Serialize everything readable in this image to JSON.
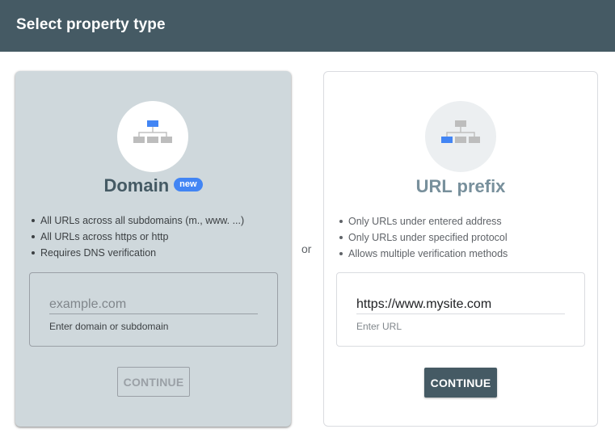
{
  "header": {
    "title": "Select property type"
  },
  "or_label": "or",
  "domain_card": {
    "title": "Domain",
    "badge": "new",
    "bullets": [
      "All URLs across all subdomains (m., www. ...)",
      "All URLs across https or http",
      "Requires DNS verification"
    ],
    "input": {
      "value": "",
      "placeholder": "example.com",
      "helper": "Enter domain or subdomain"
    },
    "continue_label": "CONTINUE",
    "continue_state": "disabled",
    "icon": "domain-hierarchy-icon"
  },
  "url_card": {
    "title": "URL prefix",
    "bullets": [
      "Only URLs under entered address",
      "Only URLs under specified protocol",
      "Allows multiple verification methods"
    ],
    "input": {
      "value": "https://www.mysite.com",
      "placeholder": "",
      "helper": "Enter URL"
    },
    "continue_label": "CONTINUE",
    "continue_state": "enabled",
    "icon": "url-prefix-hierarchy-icon"
  },
  "colors": {
    "header_bg": "#455a64",
    "selected_card_bg": "#cfd8dc",
    "accent_blue": "#4285f4",
    "icon_gray": "#bdbdbd",
    "primary_button": "#455a64"
  }
}
